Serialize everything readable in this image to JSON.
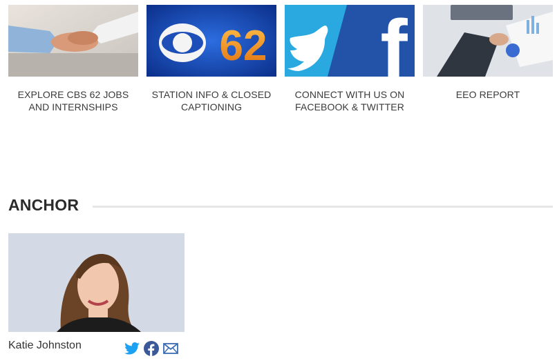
{
  "tiles": [
    {
      "caption": "EXPLORE CBS 62 JOBS AND INTERNSHIPS"
    },
    {
      "caption": "STATION INFO & CLOSED CAPTIONING",
      "logo_number": "62"
    },
    {
      "caption": "CONNECT WITH US ON FACEBOOK & TWITTER",
      "facebook_letter": "f"
    },
    {
      "caption": "EEO REPORT"
    }
  ],
  "section": {
    "title": "ANCHOR"
  },
  "anchor": {
    "name": "Katie Johnston",
    "icons": [
      "twitter-icon",
      "facebook-icon",
      "email-icon"
    ]
  },
  "colors": {
    "twitter": "#1da1f2",
    "facebook": "#3b5998",
    "cbs_blue": "#1e4fb8",
    "cbs_orange": "#f08a1c",
    "photo_bg": "#d4d9e6"
  }
}
